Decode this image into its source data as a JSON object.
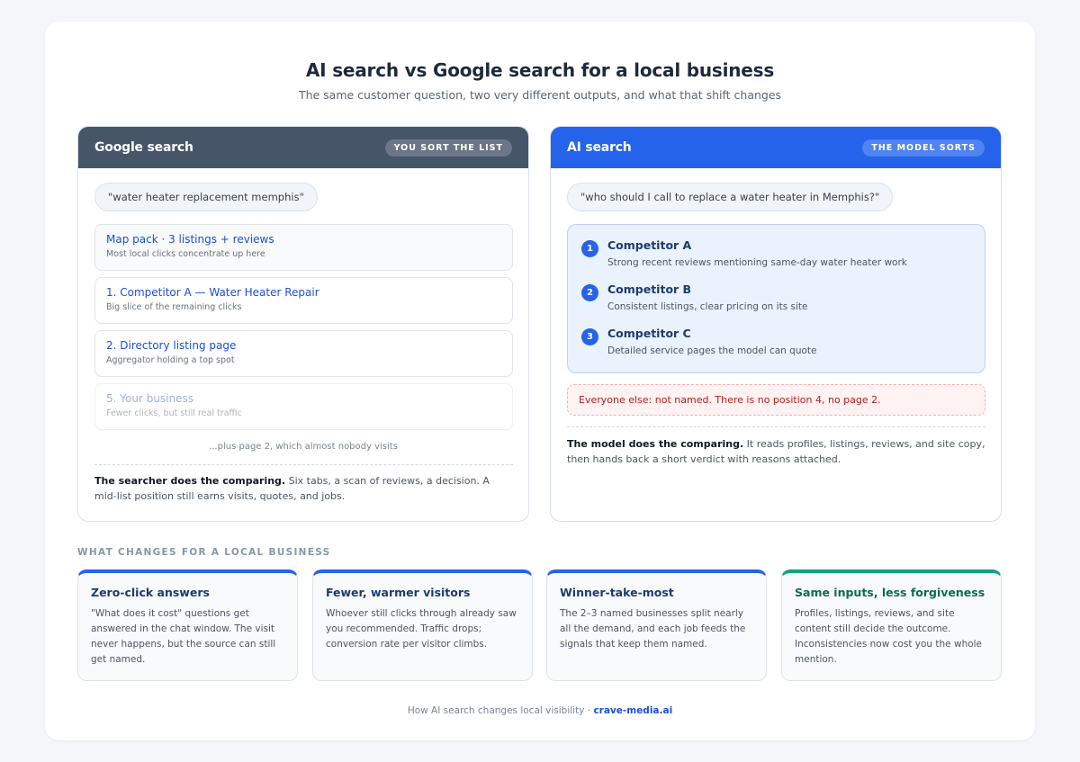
{
  "title": "AI search vs Google search for a local business",
  "subtitle": "The same customer question, two very different outputs, and what that shift changes",
  "google": {
    "title": "Google search",
    "badge": "YOU SORT THE LIST",
    "query": "\"water heater replacement memphis\"",
    "results": [
      {
        "title": "Map pack · 3 listings + reviews",
        "sub": "Most local clicks concentrate up here"
      },
      {
        "title": "1. Competitor A — Water Heater Repair",
        "sub": "Big slice of the remaining clicks"
      },
      {
        "title": "2. Directory listing page",
        "sub": "Aggregator holding a top spot"
      },
      {
        "title": "5. Your business",
        "sub": "Fewer clicks, but still real traffic"
      }
    ],
    "more": "...plus page 2, which almost nobody visits",
    "summary_bold": "The searcher does the comparing.",
    "summary_text": " Six tabs, a scan of reviews, a decision. A mid-list position still earns visits, quotes, and jobs."
  },
  "ai": {
    "title": "AI search",
    "badge": "THE MODEL SORTS",
    "query": "\"who should I call to replace a water heater in Memphis?\"",
    "ranked": [
      {
        "num": "1",
        "name": "Competitor A",
        "desc": "Strong recent reviews mentioning same-day water heater work"
      },
      {
        "num": "2",
        "name": "Competitor B",
        "desc": "Consistent listings, clear pricing on its site"
      },
      {
        "num": "3",
        "name": "Competitor C",
        "desc": "Detailed service pages the model can quote"
      }
    ],
    "alert": "Everyone else: not named. There is no position 4, no page 2.",
    "summary_bold": "The model does the comparing.",
    "summary_text": " It reads profiles, listings, reviews, and site copy, then hands back a short verdict with reasons attached."
  },
  "changes": {
    "label": "WHAT CHANGES FOR A LOCAL BUSINESS",
    "tiles": [
      {
        "title": "Zero-click answers",
        "desc": "\"What does it cost\" questions get answered in the chat window. The visit never happens, but the source can still get named.",
        "accent": "#2563eb"
      },
      {
        "title": "Fewer, warmer visitors",
        "desc": "Whoever still clicks through already saw you recommended. Traffic drops; conversion rate per visitor climbs.",
        "accent": "#2563eb"
      },
      {
        "title": "Winner-take-most",
        "desc": "The 2–3 named businesses split nearly all the demand, and each job feeds the signals that keep them named.",
        "accent": "#2563eb"
      },
      {
        "title": "Same inputs, less forgiveness",
        "desc": "Profiles, listings, reviews, and site content still decide the outcome. Inconsistencies now cost you the whole mention.",
        "accent": "#10a37f"
      }
    ]
  },
  "footer": {
    "text": "How AI search changes local visibility · ",
    "brand": "crave-media.ai"
  }
}
